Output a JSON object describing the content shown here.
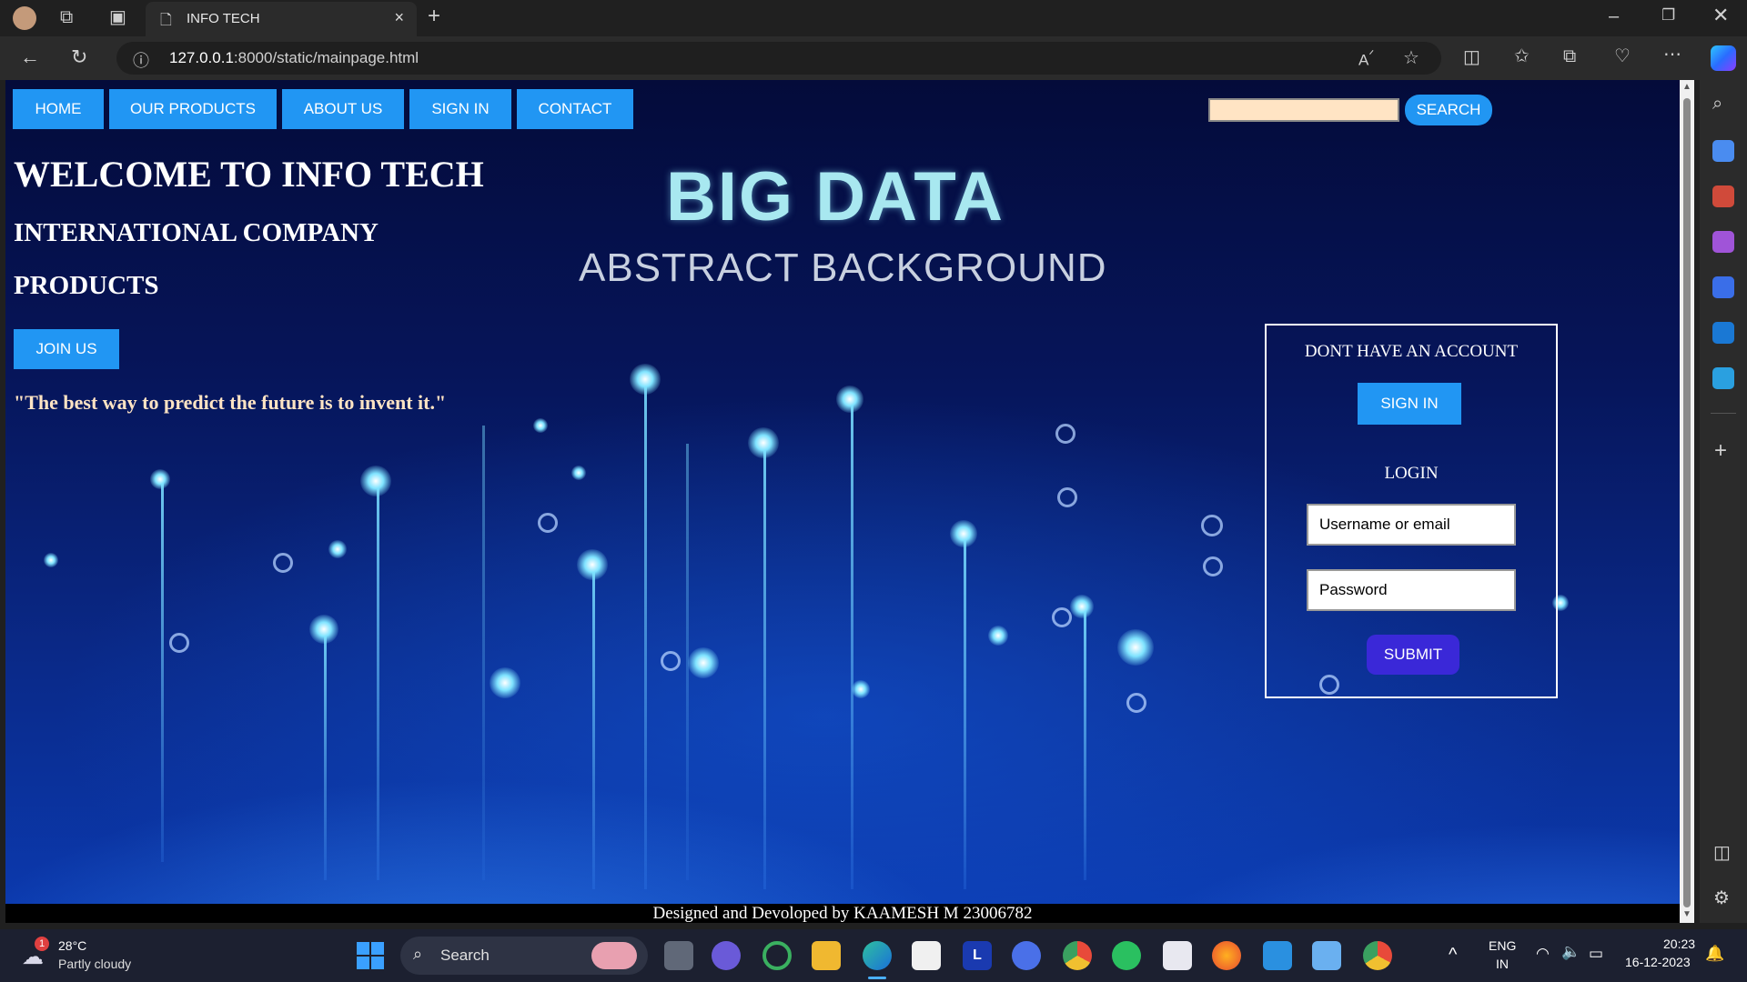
{
  "browser": {
    "tab_title": "INFO TECH",
    "url_host": "127.0.0.1",
    "url_path": ":8000/static/mainpage.html"
  },
  "nav": {
    "items": [
      {
        "label": "HOME"
      },
      {
        "label": "OUR PRODUCTS"
      },
      {
        "label": "ABOUT US"
      },
      {
        "label": "SIGN IN"
      },
      {
        "label": "CONTACT"
      }
    ],
    "search_button": "SEARCH"
  },
  "hero": {
    "welcome": "WELCOME TO INFO TECH",
    "international": "INTERNATIONAL COMPANY",
    "products": "PRODUCTS",
    "join_button": "JOIN US",
    "quote": "\"The best way to predict the future is to invent it.\"",
    "bg_title": "BIG DATA",
    "bg_subtitle": "ABSTRACT BACKGROUND"
  },
  "login_box": {
    "no_account": "DONT HAVE AN ACCOUNT",
    "sign_in_button": "SIGN IN",
    "login_heading": "LOGIN",
    "username_placeholder": "Username or email",
    "password_placeholder": "Password",
    "submit_button": "SUBMIT"
  },
  "footer": {
    "credit": "Designed and Devoloped by KAAMESH M 23006782"
  },
  "taskbar": {
    "weather_temp": "28°C",
    "weather_desc": "Partly cloudy",
    "weather_badge": "1",
    "search_label": "Search",
    "lang_top": "ENG",
    "lang_bottom": "IN",
    "time": "20:23",
    "date": "16-12-2023"
  }
}
